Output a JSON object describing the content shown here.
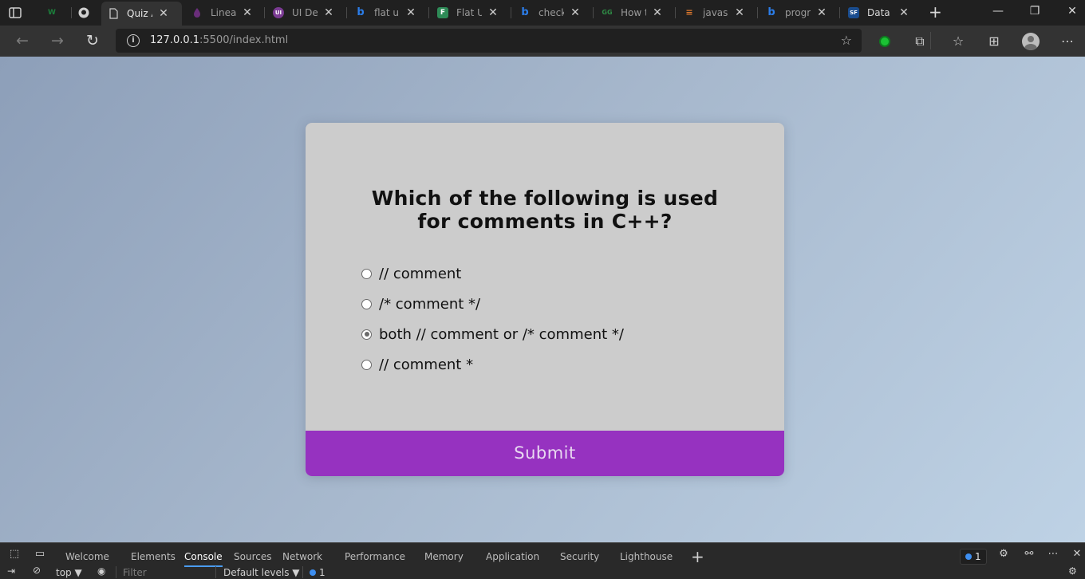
{
  "browser": {
    "tabs": [
      {
        "title": "",
        "favicon": "w",
        "favicon_color": "#1b7f3b",
        "active": false
      },
      {
        "title": "",
        "favicon": "github",
        "favicon_color": "#d0d0d0",
        "active": false
      },
      {
        "title": "Quiz A",
        "favicon": "page",
        "favicon_color": "#d0d0d0",
        "active": true
      },
      {
        "title": "Linear",
        "favicon": "drop",
        "favicon_color": "#6a2e7a",
        "active": false
      },
      {
        "title": "UI Des",
        "favicon": "UI",
        "favicon_color": "#7b3b93",
        "active": false
      },
      {
        "title": "flat ui c",
        "favicon": "b",
        "favicon_color": "#2b7de9",
        "active": false
      },
      {
        "title": "Flat UI",
        "favicon": "F",
        "favicon_color": "#2e8b57",
        "active": false
      },
      {
        "title": "check",
        "favicon": "b",
        "favicon_color": "#2b7de9",
        "active": false
      },
      {
        "title": "How tc",
        "favicon": "gg",
        "favicon_color": "#2f8d46",
        "active": false
      },
      {
        "title": "javascr",
        "favicon": "so",
        "favicon_color": "#e07a2e",
        "active": false
      },
      {
        "title": "progra",
        "favicon": "b",
        "favicon_color": "#2b7de9",
        "active": false
      },
      {
        "title": "Data Ty",
        "favicon": "SF",
        "favicon_color": "#1a4d8f",
        "active": false
      }
    ],
    "url_host": "127.0.0.1",
    "url_path": ":5500/index.html"
  },
  "quiz": {
    "question": "Which of the following is used for comments in C++?",
    "answers": [
      {
        "label": "// comment",
        "checked": false
      },
      {
        "label": "/* comment */",
        "checked": false
      },
      {
        "label": "both // comment or /* comment */",
        "checked": true
      },
      {
        "label": "// comment *",
        "checked": false
      }
    ],
    "submit_label": "Submit",
    "accent_color": "#9632c0"
  },
  "devtools": {
    "tabs": [
      "Welcome",
      "Elements",
      "Console",
      "Sources",
      "Network",
      "Performance",
      "Memory",
      "Application",
      "Security",
      "Lighthouse"
    ],
    "active_tab": "Console",
    "issues_count": "1",
    "context": "top",
    "filter_placeholder": "Filter",
    "levels": "Default levels",
    "console_issues": "1"
  }
}
